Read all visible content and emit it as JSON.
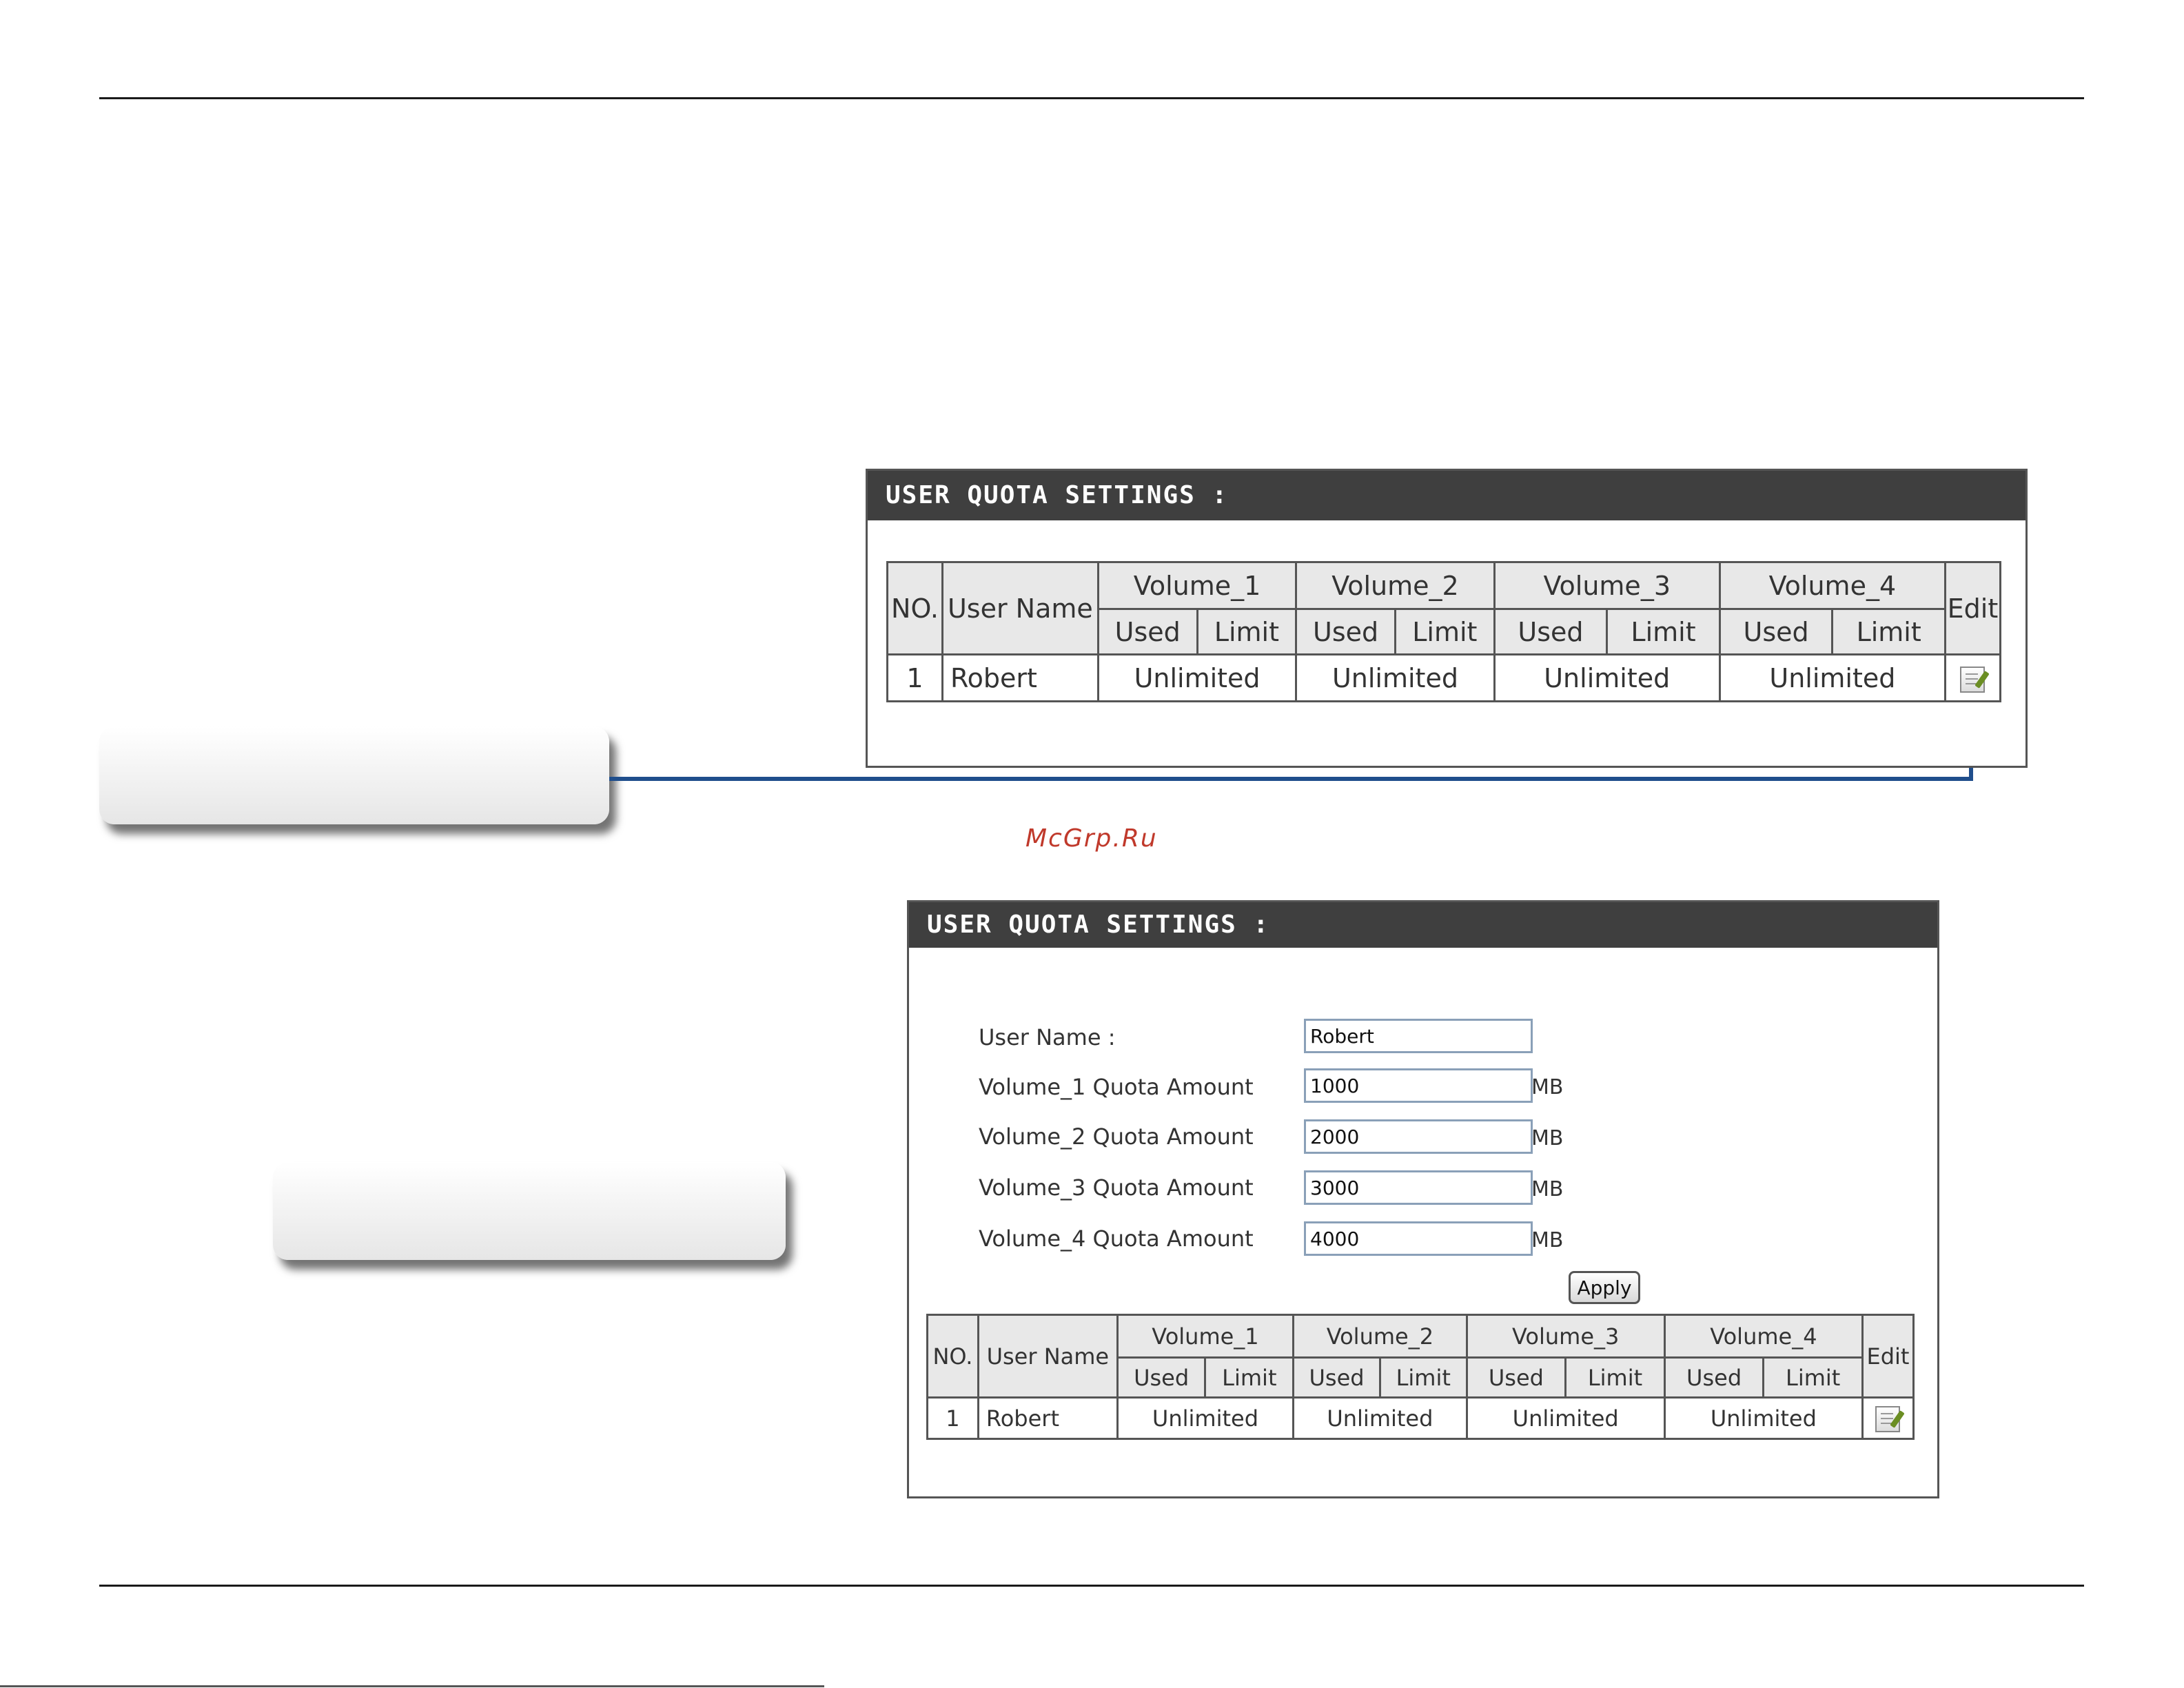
{
  "panel1": {
    "title": "USER QUOTA SETTINGS :",
    "table": {
      "headers": {
        "no": "NO.",
        "user_name": "User Name",
        "edit": "Edit"
      },
      "volumes": [
        "Volume_1",
        "Volume_2",
        "Volume_3",
        "Volume_4"
      ],
      "subheaders": {
        "used": "Used",
        "limit": "Limit"
      },
      "rows": [
        {
          "no": "1",
          "user_name": "Robert",
          "vol1": "Unlimited",
          "vol2": "Unlimited",
          "vol3": "Unlimited",
          "vol4": "Unlimited"
        }
      ]
    }
  },
  "panel2": {
    "title": "USER QUOTA SETTINGS :",
    "form": {
      "user_name_label": "User Name :",
      "user_name_value": "Robert",
      "quotas": [
        {
          "label": "Volume_1 Quota Amount",
          "value": "1000",
          "unit": "MB"
        },
        {
          "label": "Volume_2 Quota Amount",
          "value": "2000",
          "unit": "MB"
        },
        {
          "label": "Volume_3 Quota Amount",
          "value": "3000",
          "unit": "MB"
        },
        {
          "label": "Volume_4 Quota Amount",
          "value": "4000",
          "unit": "MB"
        }
      ],
      "apply_label": "Apply"
    },
    "table": {
      "headers": {
        "no": "NO.",
        "user_name": "User Name",
        "edit": "Edit"
      },
      "volumes": [
        "Volume_1",
        "Volume_2",
        "Volume_3",
        "Volume_4"
      ],
      "subheaders": {
        "used": "Used",
        "limit": "Limit"
      },
      "rows": [
        {
          "no": "1",
          "user_name": "Robert",
          "vol1": "Unlimited",
          "vol2": "Unlimited",
          "vol3": "Unlimited",
          "vol4": "Unlimited"
        }
      ]
    }
  },
  "watermark": "McGrp.Ru",
  "icons": {
    "edit": "edit-icon",
    "arrow": "arrow-up-icon"
  },
  "colors": {
    "header_bg": "#3f3f3f",
    "arrow": "#1f4e8c",
    "watermark": "#c0392b"
  }
}
